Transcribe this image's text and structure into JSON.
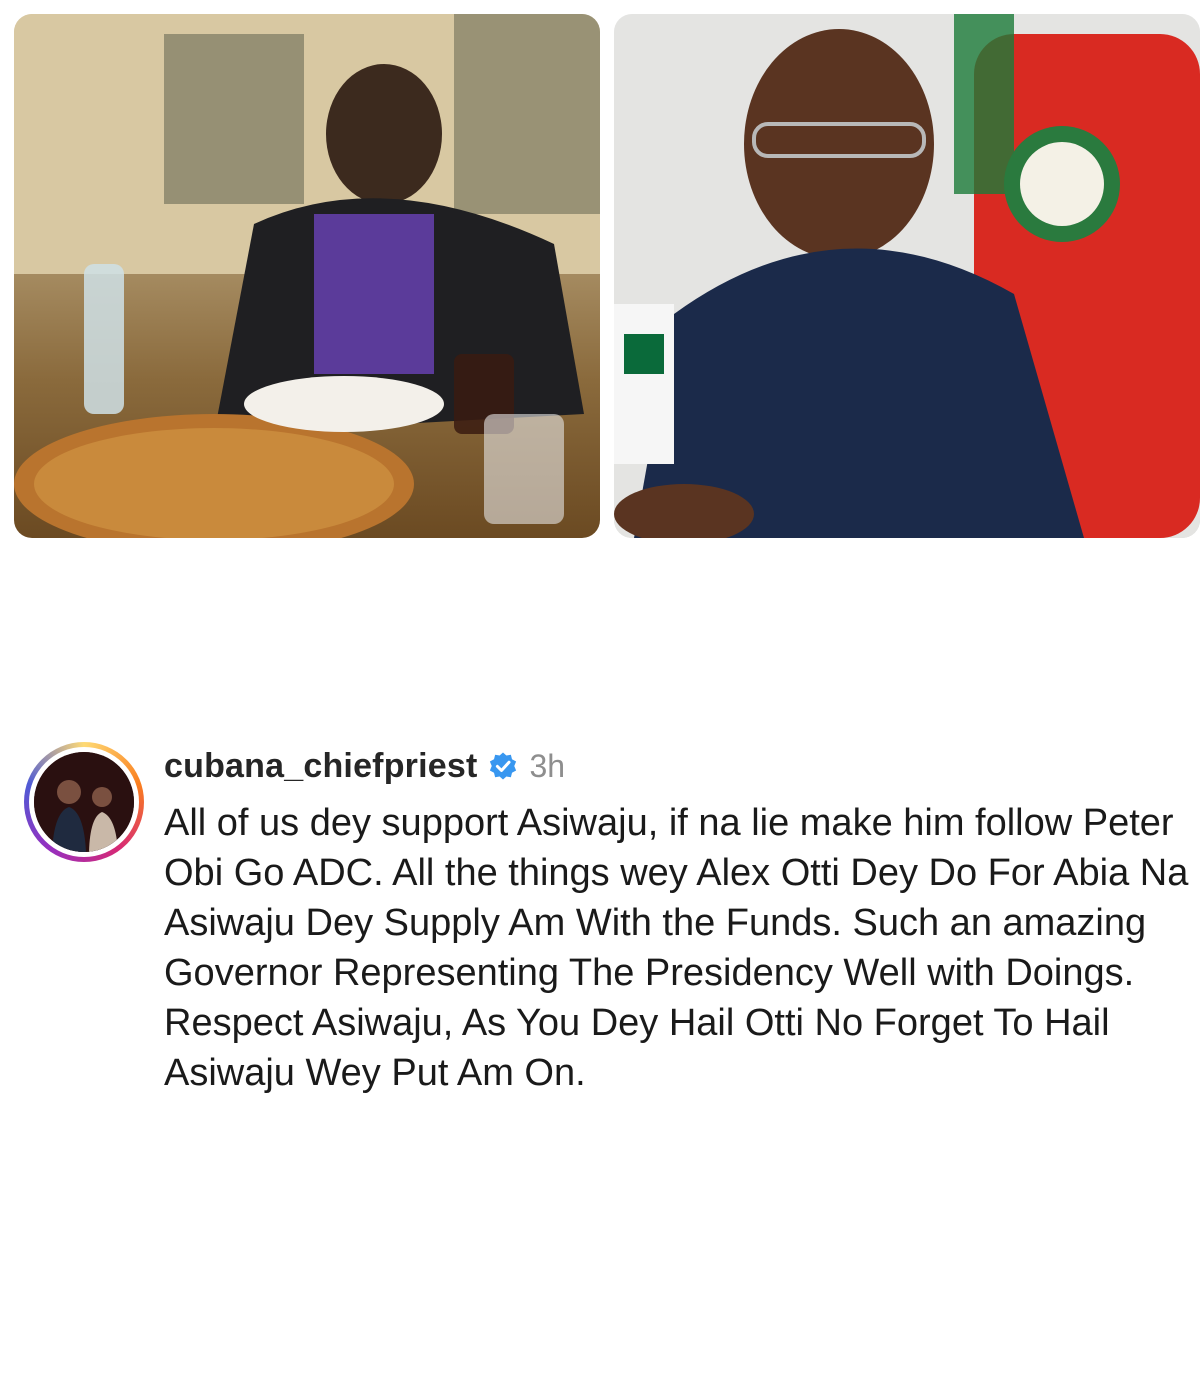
{
  "photos": [
    {
      "name": "left-photo",
      "description_visible": ""
    },
    {
      "name": "right-photo",
      "description_visible": ""
    }
  ],
  "comment": {
    "username": "cubana_chiefpriest",
    "verified": true,
    "time": "3h",
    "text": "All of us dey support Asiwaju, if na lie make him follow Peter Obi Go ADC. All the things wey Alex Otti Dey Do For Abia Na Asiwaju Dey Supply Am With the Funds. Such an amazing Governor Representing The Presidency Well with Doings. Respect Asiwaju, As You Dey Hail Otti No Forget To Hail Asiwaju Wey Put Am On."
  },
  "icons": {
    "verified": "verified-badge-icon"
  },
  "colors": {
    "username": "#262626",
    "time": "#8e8e8e",
    "verified": "#3897f0"
  }
}
